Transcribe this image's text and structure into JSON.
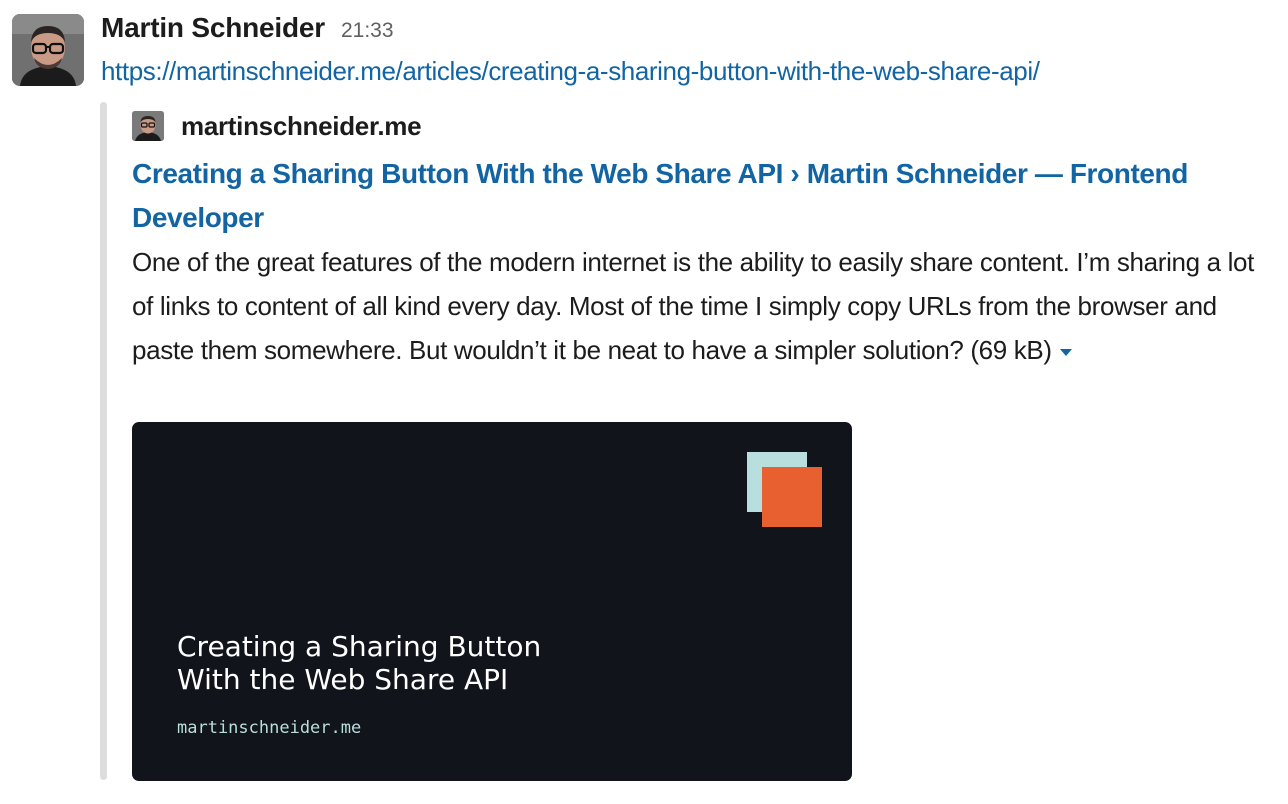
{
  "message": {
    "author": "Martin Schneider",
    "timestamp": "21:33",
    "url": "https://martinschneider.me/articles/creating-a-sharing-button-with-the-web-share-api/"
  },
  "unfurl": {
    "site_name": "martinschneider.me",
    "title": "Creating a Sharing Button With the Web Share API › Martin Schneider — Frontend Developer",
    "description": "One of the great features of the modern internet is the ability to easily share content. I’m sharing a lot of links to content of all kind every day. Most of the time I simply copy URLs from the browser and paste them somewhere. But wouldn’t it be neat to have a simpler solution?",
    "file_size": "(69 kB)",
    "toggle_icon": "caret-down-icon"
  },
  "preview_image": {
    "title": "Creating a Sharing Button\nWith the Web Share API",
    "site": "martinschneider.me",
    "colors": {
      "background": "#12141c",
      "square_light": "#b8dedd",
      "square_accent": "#e85f30"
    }
  },
  "colors": {
    "link": "#1264a3",
    "text": "#1d1c1d",
    "muted": "#616061",
    "attachment_bar": "#dddddd"
  }
}
